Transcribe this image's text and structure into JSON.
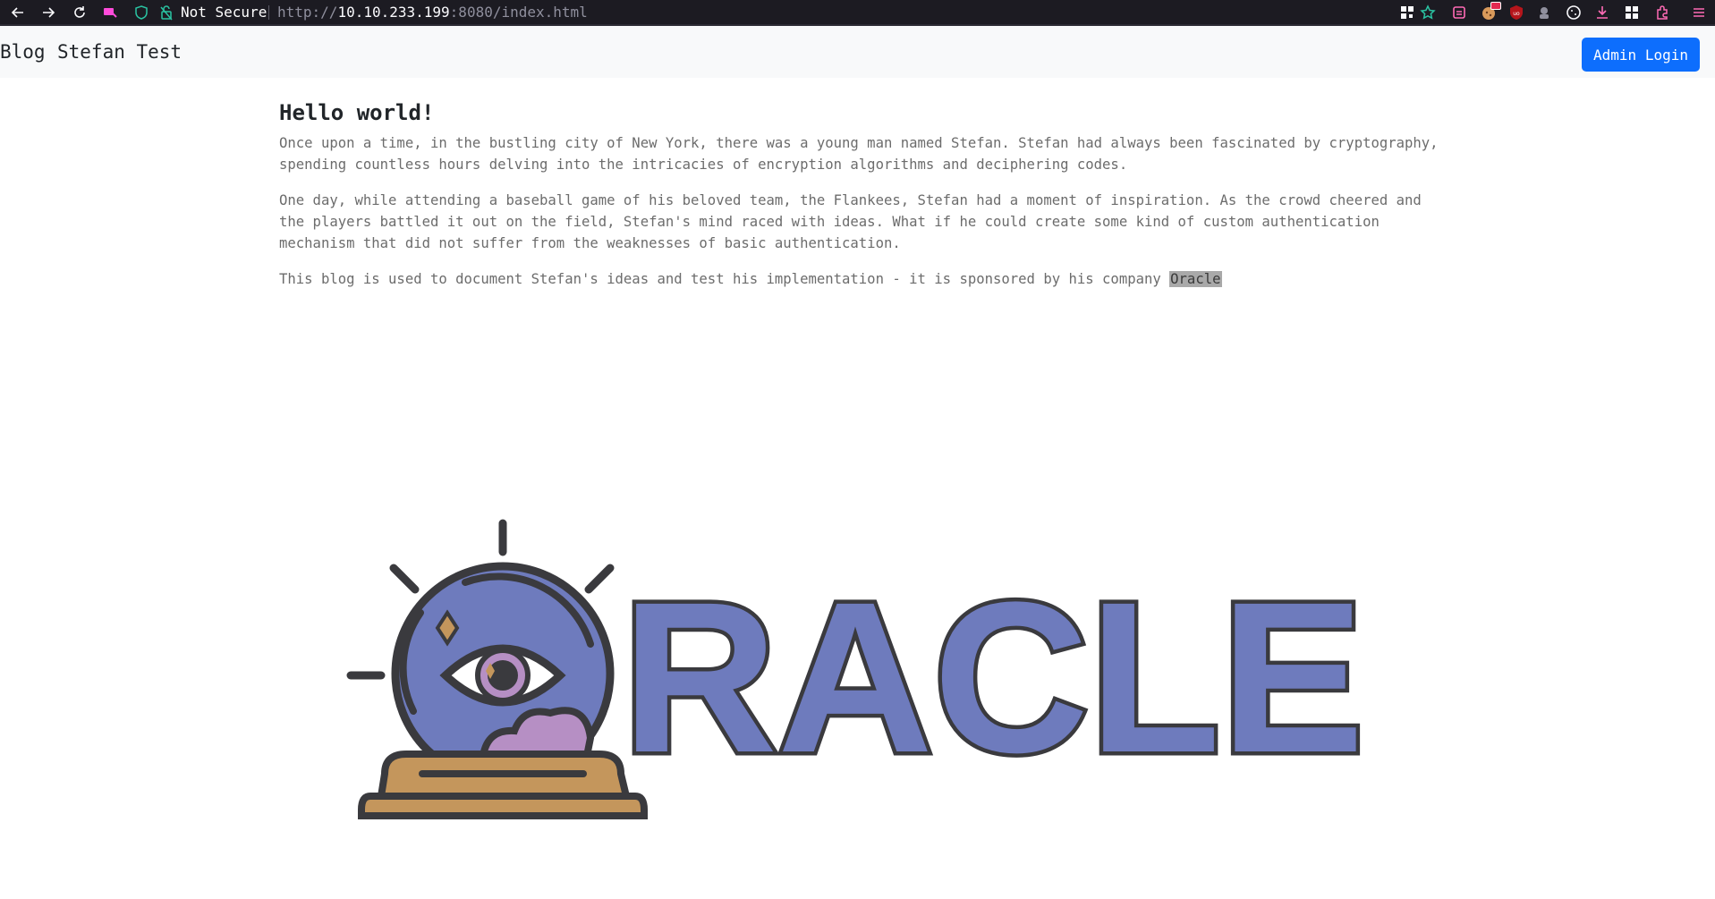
{
  "browser": {
    "security_label": "Not Secure",
    "url_prefix": "http://",
    "url_host": "10.10.233.199",
    "url_path": ":8080/index.html",
    "icons": [
      "back-arrow-icon",
      "forward-arrow-icon",
      "reload-icon",
      "container-icon",
      "shield-icon",
      "lock-icon",
      "qr-icon",
      "bookmark-star-icon",
      "reader-icon",
      "cookie-extension-icon",
      "ublock-icon",
      "extension-icon",
      "cookie-icon",
      "download-icon",
      "grid-icon",
      "puzzle-icon",
      "menu-icon"
    ],
    "colors": {
      "bar": "#1c1b22",
      "secure_green": "#2ac3a2"
    }
  },
  "navbar": {
    "brand": "Blog",
    "link": "Stefan Test",
    "admin_button": "Admin Login",
    "button_color": "#0d6efd"
  },
  "post": {
    "title": "Hello world!",
    "paragraph1": "Once upon a time, in the bustling city of New York, there was a young man named Stefan. Stefan had always been fascinated by cryptography, spending countless hours delving into the intricacies of encryption algorithms and deciphering codes.",
    "paragraph2": "One day, while attending a baseball game of his beloved team, the Flankees, Stefan had a moment of inspiration. As the crowd cheered and the players battled it out on the field, Stefan's mind raced with ideas. What if he could create some kind of custom authentication mechanism that did not suffer from the weaknesses of basic authentication.",
    "paragraph3_text": "This blog is used to document Stefan's ideas and test his implementation - it is sponsored by his company ",
    "paragraph3_highlight": "Oracle"
  },
  "logo": {
    "text": "RACLE",
    "colors": {
      "fill": "#6e7bbd",
      "outline": "#3a3a3e",
      "iris": "#b68fc4",
      "base": "#c4965c",
      "cloud": "#b68fc4"
    }
  }
}
